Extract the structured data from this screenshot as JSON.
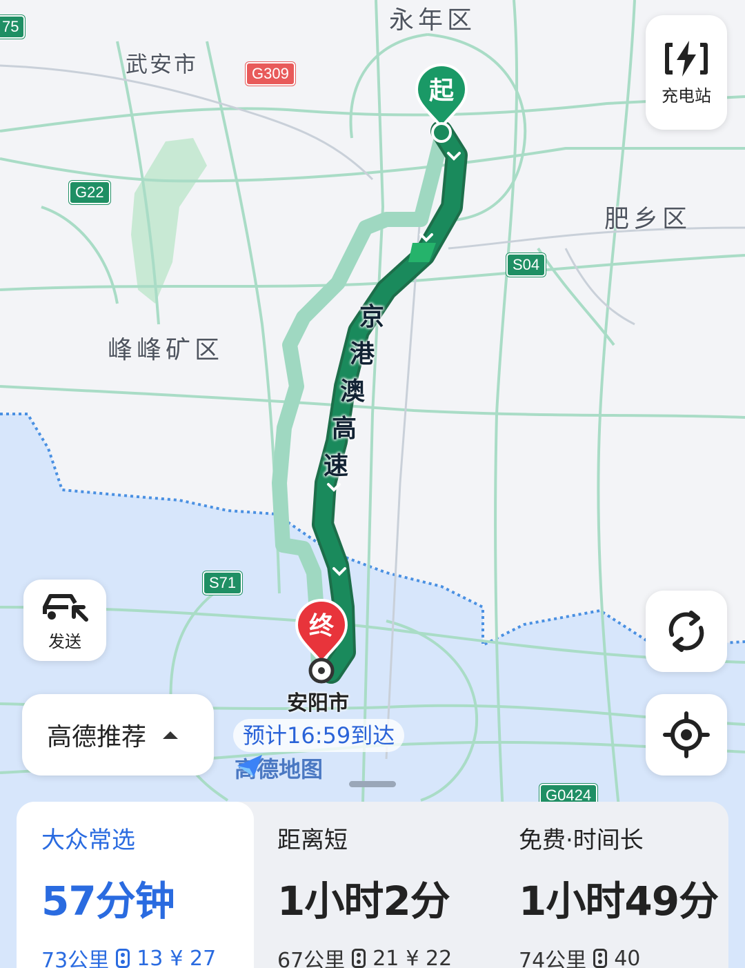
{
  "map": {
    "districts": {
      "yongnian": "永年区",
      "wuan": "武安市",
      "feixiang": "肥乡区",
      "fengfeng": "峰峰矿区",
      "anyang": "安阳市"
    },
    "highway_shields": {
      "g309": "G309",
      "g22": "G22",
      "s04": "S04",
      "s71": "S71",
      "g0424": "G0424",
      "edge": "75"
    },
    "road_name": [
      "京",
      "港",
      "澳",
      "高",
      "速"
    ],
    "start_pin": "起",
    "end_pin": "终",
    "eta": "预计16:59到达",
    "logo": "高德地图",
    "colors": {
      "route_main": "#1a8a5c",
      "route_alt": "#9fd8c1",
      "province_fill": "#d7e6fb",
      "start_pin": "#1a9966",
      "end_pin": "#e8343b",
      "accent": "#2a6be0"
    }
  },
  "controls": {
    "charging": {
      "icon": "charging-station-icon",
      "label": "充电站"
    },
    "send": {
      "icon": "car-send-icon",
      "label": "发送"
    },
    "refresh_icon": "refresh-icon",
    "locate_icon": "locate-icon",
    "preference": "高德推荐"
  },
  "routes": [
    {
      "tag": "大众常选",
      "time": "57分钟",
      "distance": "73公里",
      "lights": "13",
      "toll": "¥ 27",
      "selected": true
    },
    {
      "tag": "距离短",
      "time": "1小时2分",
      "distance": "67公里",
      "lights": "21",
      "toll": "¥ 22",
      "selected": false
    },
    {
      "tag": "免费·时间长",
      "time": "1小时49分",
      "distance": "74公里",
      "lights": "40",
      "toll": "",
      "selected": false
    }
  ]
}
